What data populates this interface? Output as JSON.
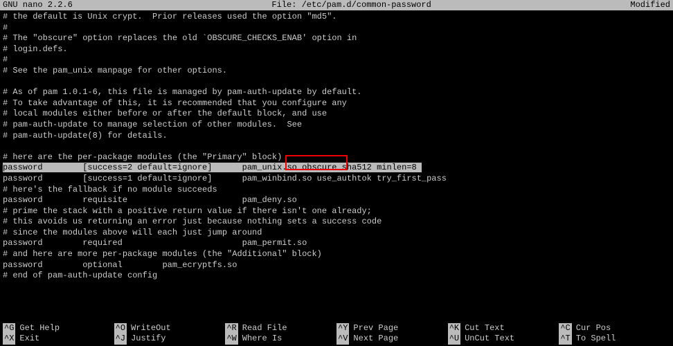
{
  "titlebar": {
    "app": "  GNU nano 2.2.6",
    "file": "File: /etc/pam.d/common-password",
    "status": "Modified"
  },
  "content": {
    "lines": [
      "# the default is Unix crypt.  Prior releases used the option \"md5\".",
      "#",
      "# The \"obscure\" option replaces the old `OBSCURE_CHECKS_ENAB' option in",
      "# login.defs.",
      "#",
      "# See the pam_unix manpage for other options.",
      "",
      "# As of pam 1.0.1-6, this file is managed by pam-auth-update by default.",
      "# To take advantage of this, it is recommended that you configure any",
      "# local modules either before or after the default block, and use",
      "# pam-auth-update to manage selection of other modules.  See",
      "# pam-auth-update(8) for details.",
      "",
      "# here are the per-package modules (the \"Primary\" block)"
    ],
    "highlight": "password        [success=2 default=ignore]      pam_unix.so obscure sha512 minlen=8",
    "lines2": [
      "password        [success=1 default=ignore]      pam_winbind.so use_authtok try_first_pass",
      "# here's the fallback if no module succeeds",
      "password        requisite                       pam_deny.so",
      "# prime the stack with a positive return value if there isn't one already;",
      "# this avoids us returning an error just because nothing sets a success code",
      "# since the modules above will each just jump around",
      "password        required                        pam_permit.so",
      "# and here are more per-package modules (the \"Additional\" block)",
      "password        optional        pam_ecryptfs.so ",
      "# end of pam-auth-update config"
    ]
  },
  "shortcuts": {
    "row1": [
      {
        "key": "^G",
        "label": "Get Help"
      },
      {
        "key": "^O",
        "label": "WriteOut"
      },
      {
        "key": "^R",
        "label": "Read File"
      },
      {
        "key": "^Y",
        "label": "Prev Page"
      },
      {
        "key": "^K",
        "label": "Cut Text"
      },
      {
        "key": "^C",
        "label": "Cur Pos"
      }
    ],
    "row2": [
      {
        "key": "^X",
        "label": "Exit"
      },
      {
        "key": "^J",
        "label": "Justify"
      },
      {
        "key": "^W",
        "label": "Where Is"
      },
      {
        "key": "^V",
        "label": "Next Page"
      },
      {
        "key": "^U",
        "label": "UnCut Text"
      },
      {
        "key": "^T",
        "label": "To Spell"
      }
    ]
  }
}
